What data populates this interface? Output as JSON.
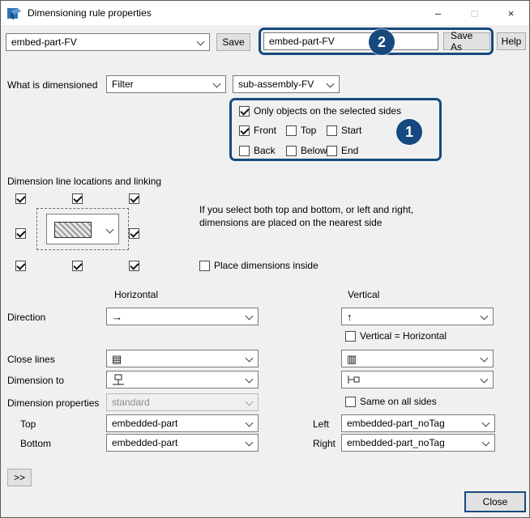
{
  "window": {
    "title": "Dimensioning rule properties",
    "minimize_glyph": "–",
    "maximize_glyph": "□",
    "close_glyph": "×"
  },
  "toolbar": {
    "rule_combo_value": "embed-part-FV",
    "save_label": "Save",
    "name_input_value": "embed-part-FV",
    "save_as_label": "Save As",
    "help_label": "Help"
  },
  "what": {
    "label": "What is dimensioned",
    "type_value": "Filter",
    "filter_value": "sub-assembly-FV"
  },
  "sides": {
    "only_label": "Only objects on the selected sides",
    "only_checked": true,
    "items": [
      {
        "label": "Front",
        "checked": true
      },
      {
        "label": "Top",
        "checked": false
      },
      {
        "label": "Start",
        "checked": false
      },
      {
        "label": "Back",
        "checked": false
      },
      {
        "label": "Below",
        "checked": false
      },
      {
        "label": "End",
        "checked": false
      }
    ]
  },
  "locations": {
    "label": "Dimension line locations and linking",
    "grid": {
      "top_left": true,
      "top_center": true,
      "top_right": true,
      "mid_left": true,
      "mid_right": true,
      "bottom_left": true,
      "bottom_center": true,
      "bottom_right": true
    },
    "note": "If you select both top and bottom, or left and right, dimensions are placed on the nearest side",
    "place_inside_label": "Place dimensions inside",
    "place_inside_checked": false
  },
  "columns": {
    "horizontal": "Horizontal",
    "vertical": "Vertical"
  },
  "rows": {
    "direction_label": "Direction",
    "vertical_equals_label": "Vertical = Horizontal",
    "vertical_equals_checked": false,
    "close_lines_label": "Close lines",
    "dimension_to_label": "Dimension to",
    "dimension_properties_label": "Dimension properties",
    "dimension_properties_value": "standard",
    "same_on_all_label": "Same on all sides",
    "same_on_all_checked": false,
    "top_label": "Top",
    "top_value": "embedded-part",
    "bottom_label": "Bottom",
    "bottom_value": "embedded-part",
    "left_label": "Left",
    "left_value": "embedded-part_noTag",
    "right_label": "Right",
    "right_value": "embedded-part_noTag"
  },
  "icons": {
    "direction_horizontal_glyph": "→",
    "direction_vertical_glyph": "↑",
    "close_lines_horizontal_glyph": "▤",
    "close_lines_vertical_glyph": "▥"
  },
  "footer": {
    "expand_label": ">>",
    "close_label": "Close"
  },
  "annotations": {
    "step1": "1",
    "step2": "2",
    "accent": "#17497e"
  }
}
